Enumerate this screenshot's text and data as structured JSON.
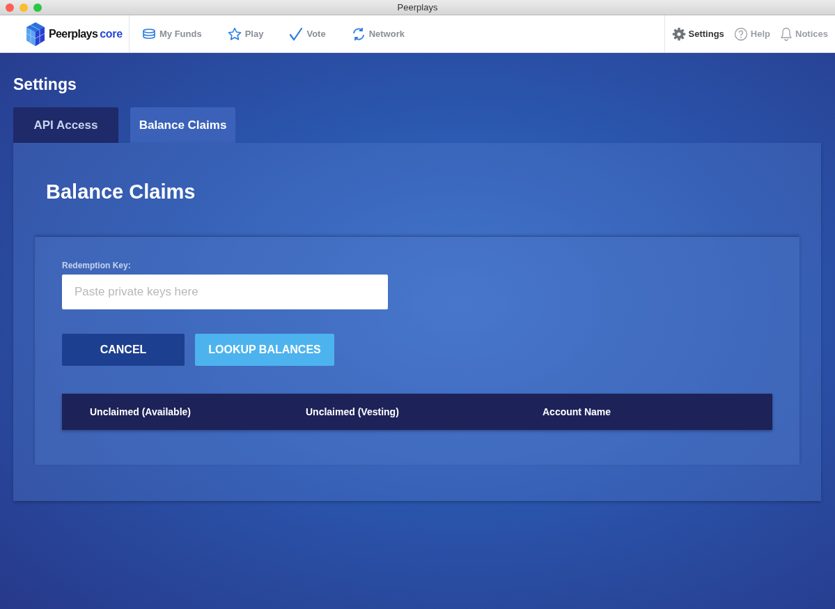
{
  "window": {
    "title": "Peerplays"
  },
  "brand": {
    "name": "Peerplays",
    "suffix": "core"
  },
  "nav": [
    {
      "label": "My Funds",
      "kind": "funds",
      "selected": false
    },
    {
      "label": "Play",
      "kind": "play",
      "selected": false
    },
    {
      "label": "Vote",
      "kind": "vote",
      "selected": false
    },
    {
      "label": "Network",
      "kind": "network",
      "selected": false
    }
  ],
  "nav_right": [
    {
      "label": "Settings",
      "kind": "settings",
      "selected": true
    },
    {
      "label": "Help",
      "kind": "help",
      "selected": false
    },
    {
      "label": "Notices",
      "kind": "notices",
      "selected": false
    }
  ],
  "page_title": "Settings",
  "tabs": [
    {
      "label": "API Access",
      "selected": false
    },
    {
      "label": "Balance Claims",
      "selected": true
    }
  ],
  "panel": {
    "title": "Balance Claims",
    "field": {
      "label": "Redemption Key:",
      "placeholder": "Paste private keys here"
    },
    "buttons": [
      {
        "label": "CANCEL",
        "kind": "secondary"
      },
      {
        "label": "LOOKUP BALANCES",
        "kind": "primary"
      }
    ],
    "table": {
      "columns": [
        "Unclaimed (Available)",
        "Unclaimed (Vesting)",
        "Account Name"
      ]
    }
  }
}
